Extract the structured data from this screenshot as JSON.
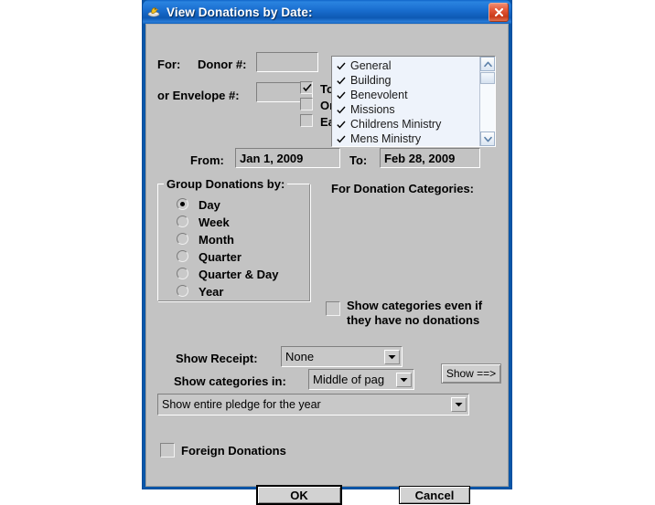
{
  "window": {
    "title": "View Donations by Date:",
    "title_icon": "duck-icon",
    "close_label": "Close",
    "titlebar_color": "#1a6fd0",
    "client_color": "#c3c3c3"
  },
  "donor_section": {
    "for_label": "For:",
    "donor_number_label": "Donor #:",
    "donor_number_value": "",
    "envelope_label": "or Envelope #:",
    "envelope_value": "",
    "options": [
      {
        "label": "Total All Donors",
        "checked": true
      },
      {
        "label": "One donor per page",
        "checked": false
      },
      {
        "label": "Each donation for all donors",
        "checked": false
      }
    ]
  },
  "date_range": {
    "from_label": "From:",
    "from_value": "Jan 1, 2009",
    "to_label": "To:",
    "to_value": "Feb 28, 2009"
  },
  "group_by": {
    "legend": "Group Donations by:",
    "options": [
      {
        "label": "Day",
        "selected": true
      },
      {
        "label": "Week",
        "selected": false
      },
      {
        "label": "Month",
        "selected": false
      },
      {
        "label": "Quarter",
        "selected": false
      },
      {
        "label": "Quarter & Day",
        "selected": false
      },
      {
        "label": "Year",
        "selected": false
      }
    ]
  },
  "categories": {
    "title": "For Donation Categories:",
    "items": [
      {
        "label": "General",
        "checked": true
      },
      {
        "label": "Building",
        "checked": true
      },
      {
        "label": "Benevolent",
        "checked": true
      },
      {
        "label": "Missions",
        "checked": true
      },
      {
        "label": "Childrens Ministry",
        "checked": true
      },
      {
        "label": "Mens Ministry",
        "checked": true
      }
    ],
    "show_empty_line1": "Show categories even if",
    "show_empty_line2": "they have no donations",
    "show_empty_checked": false
  },
  "receipt": {
    "label": "Show Receipt:",
    "value": "None"
  },
  "categories_position": {
    "label": "Show categories in:",
    "value": "Middle of pag"
  },
  "show_button": {
    "label": "Show ==>"
  },
  "pledge": {
    "value": "Show entire pledge for the year"
  },
  "foreign": {
    "label": "Foreign Donations",
    "checked": false
  },
  "footer": {
    "ok_label": "OK",
    "cancel_label": "Cancel"
  }
}
